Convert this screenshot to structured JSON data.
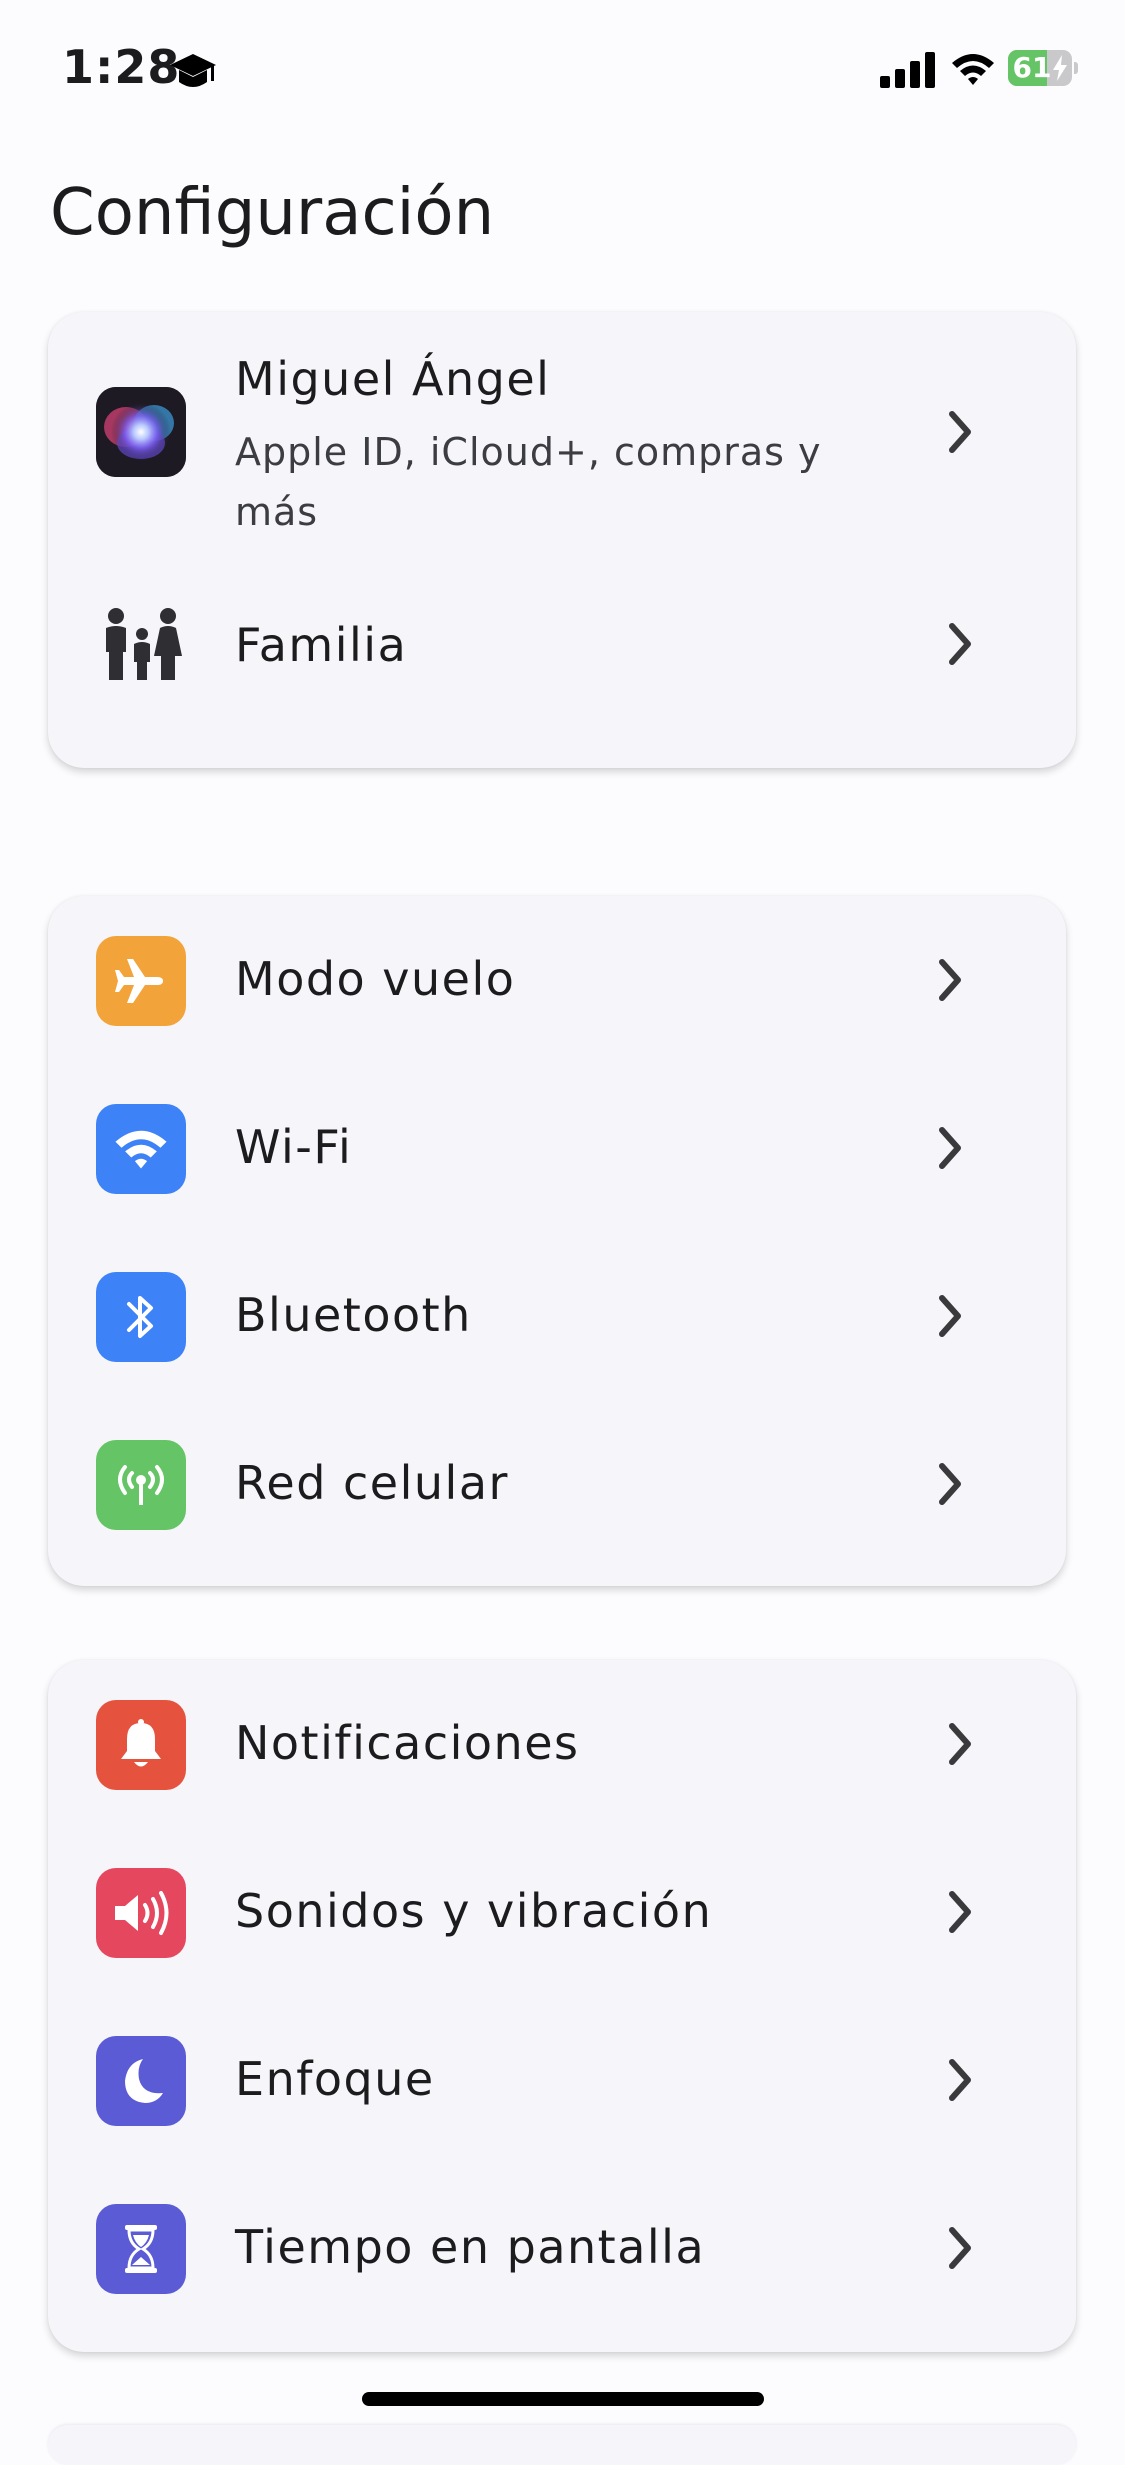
{
  "status_bar": {
    "time": "1:28",
    "battery_percent": "61",
    "battery_level": 0.61,
    "icons": [
      "graduation-cap-icon",
      "cellular-signal-icon",
      "wifi-icon",
      "battery-charging-icon"
    ]
  },
  "page": {
    "title": "Configuración"
  },
  "account_group": {
    "profile": {
      "name": "Miguel Ángel",
      "subtitle": "Apple ID, iCloud+, compras y más",
      "icon": "siri-avatar-icon"
    },
    "family": {
      "label": "Familia",
      "icon": "family-icon"
    }
  },
  "connectivity_group": {
    "items": [
      {
        "label": "Modo vuelo",
        "icon": "airplane-icon",
        "color": "#f2a33a"
      },
      {
        "label": "Wi-Fi",
        "icon": "wifi-icon",
        "color": "#3d82f6"
      },
      {
        "label": "Bluetooth",
        "icon": "bluetooth-icon",
        "color": "#3d82f6"
      },
      {
        "label": "Red celular",
        "icon": "cellular-antenna-icon",
        "color": "#65c466"
      }
    ]
  },
  "alerts_group": {
    "items": [
      {
        "label": "Notificaciones",
        "icon": "bell-icon",
        "color": "#e5533f"
      },
      {
        "label": "Sonidos y vibración",
        "icon": "speaker-icon",
        "color": "#e5475f"
      },
      {
        "label": "Enfoque",
        "icon": "moon-icon",
        "color": "#5b5bd6"
      },
      {
        "label": "Tiempo en pantalla",
        "icon": "hourglass-icon",
        "color": "#5b5bd6"
      }
    ]
  },
  "colors": {
    "background": "#fcfcfe",
    "card": "#f6f6fa",
    "text": "#1c1c1e",
    "battery_green": "#65c466"
  }
}
